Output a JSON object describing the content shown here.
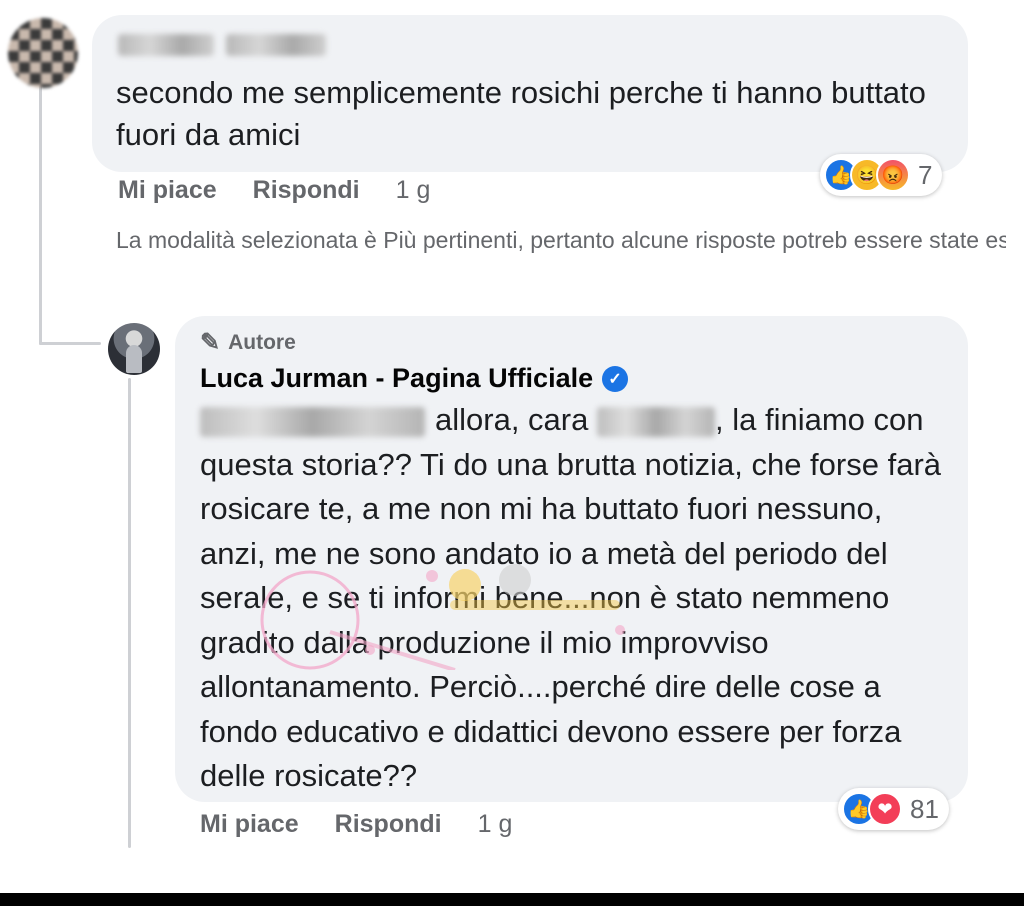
{
  "comment1": {
    "text": "secondo me semplicemente rosichi perche ti hanno buttato fuori da amici",
    "actions": {
      "like": "Mi piace",
      "reply": "Rispondi",
      "time": "1 g"
    },
    "reactions": {
      "icons": [
        "like-icon",
        "haha-icon",
        "angry-icon"
      ],
      "count": "7"
    }
  },
  "notice": {
    "text": "La modalità selezionata è Più pertinenti, pertanto alcune risposte potreb essere state escluse."
  },
  "reply": {
    "badge": "Autore",
    "author": "Luca Jurman - Pagina Ufficiale",
    "text_part1": "allora, cara",
    "text_part2": ", la finiamo con questa storia?? Ti do una brutta notizia, che forse farà rosicare te, a me non mi ha buttato fuori nessuno, anzi, me ne sono andato io a metà del periodo del serale, e se ti informi bene...non è stato nemmeno gradito dalla produzione il mio improvviso allontanamento. Perciò....perché dire delle cose a fondo educativo e didattici devono essere per forza delle rosicate??",
    "actions": {
      "like": "Mi piace",
      "reply": "Rispondi",
      "time": "1 g"
    },
    "reactions": {
      "icons": [
        "like-icon",
        "love-icon"
      ],
      "count": "81"
    }
  },
  "colors": {
    "bubble": "#f0f2f5",
    "meta_text": "#65676b",
    "like_blue": "#1b74e4",
    "love_red": "#f33e58"
  }
}
